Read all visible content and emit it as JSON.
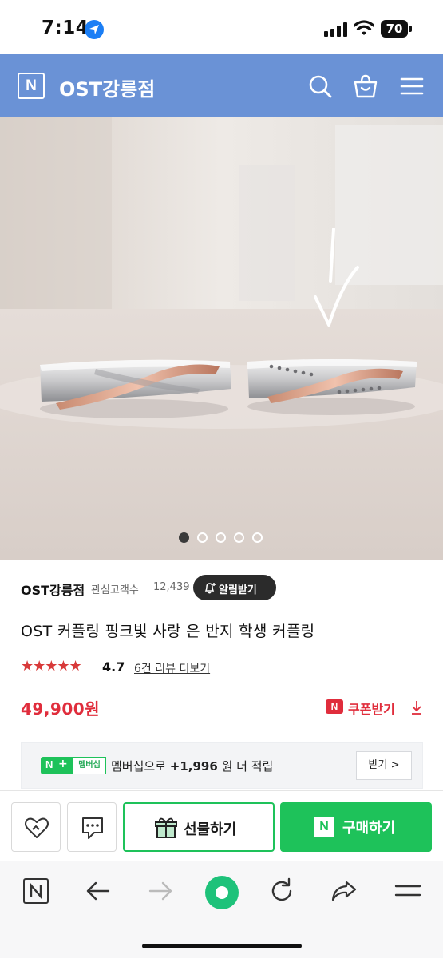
{
  "status_bar": {
    "time": "7:14",
    "battery": "70"
  },
  "header": {
    "logo": "N",
    "store_name": "OST강릉점",
    "icons": [
      "search-icon",
      "shopping-bag-icon",
      "menu-icon"
    ],
    "color": "#6a92d6"
  },
  "gallery": {
    "slides": 5,
    "active_slide": 1
  },
  "store": {
    "name": "OST강릉점",
    "fans_label": "관심고객수",
    "fans_count": "12,439",
    "alarm_button": "알림받기"
  },
  "product": {
    "title": "OST 커플링 핑크빛 사랑 은 반지 학생 커플링",
    "stars": "★★★★★",
    "rating": "4.7",
    "review_link": "6건 리뷰 더보기",
    "price": "49,900원",
    "price_color": "#e02d3c"
  },
  "coupon": {
    "badge": "N",
    "label": "쿠폰받기"
  },
  "membership": {
    "badge_n": "N",
    "badge_plus": "+",
    "badge_label": "멤버십",
    "text_pre": "멤버십으로 ",
    "points": "+1,996",
    "text_post": " 원 더 적립",
    "button": "받기 >"
  },
  "buy_bar": {
    "wishlist_icon": "heart-icon",
    "talk_icon": "chat-icon",
    "gift_label": "선물하기",
    "buy_badge": "N",
    "buy_label": "구매하기",
    "accent": "#1ec25a"
  },
  "browser_toolbar": {
    "icons": [
      "naver-home-icon",
      "back-arrow-icon",
      "forward-arrow-icon",
      "green-dot-home-icon",
      "refresh-icon",
      "share-icon",
      "menu-icon"
    ]
  }
}
